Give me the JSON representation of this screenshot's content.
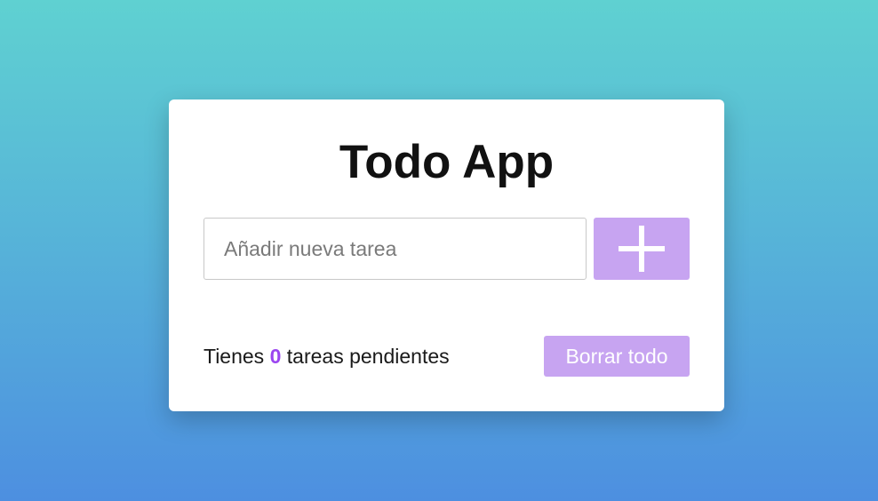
{
  "app": {
    "title": "Todo App"
  },
  "input": {
    "placeholder": "Añadir nueva tarea",
    "value": ""
  },
  "add_button": {
    "icon": "plus-icon"
  },
  "footer": {
    "prefix": "Tienes",
    "count": "0",
    "suffix": "tareas pendientes",
    "clear_label": "Borrar todo"
  },
  "colors": {
    "accent": "#c7a4f1",
    "count_color": "#9b45f0",
    "background_top": "#5fd1d1",
    "background_bottom": "#4d8fe0"
  }
}
